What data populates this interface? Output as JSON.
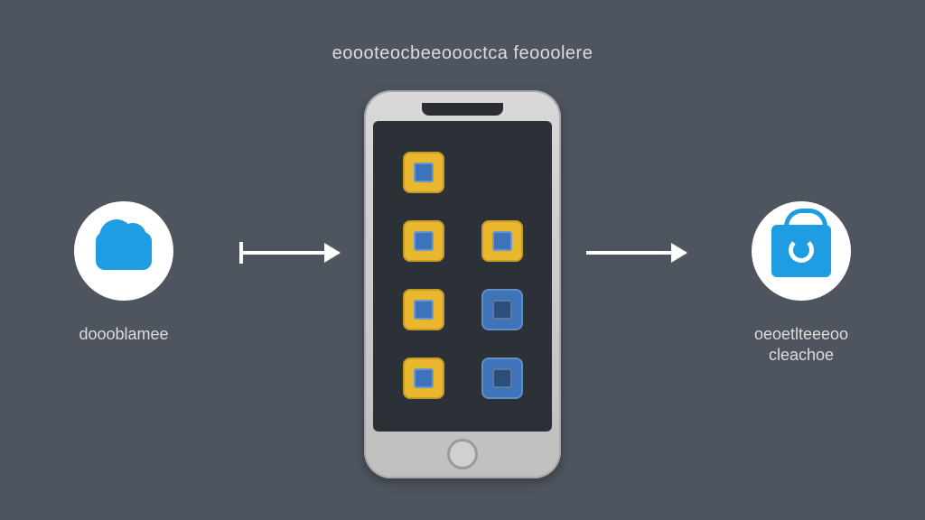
{
  "title": "eoooteocbeeoooctca feooolere",
  "left_node": {
    "icon": "cloud-icon",
    "label": "doooblamee"
  },
  "right_node": {
    "icon": "shopping-bag-icon",
    "label_line1": "oeoetlteeeoo",
    "label_line2": "cleachoe"
  },
  "phone": {
    "app_grid": [
      {
        "type": "yellow",
        "name": "app-1"
      },
      {
        "type": "empty",
        "name": "empty-slot"
      },
      {
        "type": "yellow",
        "name": "app-2"
      },
      {
        "type": "yellow",
        "name": "app-3"
      },
      {
        "type": "yellow",
        "name": "app-4"
      },
      {
        "type": "blue",
        "name": "app-5"
      },
      {
        "type": "yellow",
        "name": "app-6"
      },
      {
        "type": "blue",
        "name": "app-7"
      }
    ]
  },
  "colors": {
    "background": "#4e555e",
    "accent_blue": "#1e9de3",
    "icon_yellow": "#e9b82f",
    "icon_blue": "#3d73b8",
    "phone_screen": "#2c3138"
  }
}
